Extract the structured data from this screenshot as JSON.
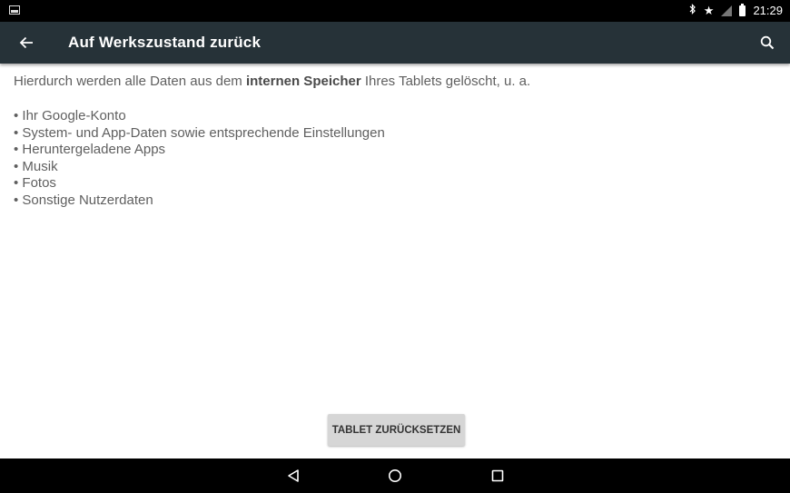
{
  "status_bar": {
    "time": "21:29",
    "icons": [
      "picture-icon",
      "bluetooth-icon",
      "star-icon",
      "signal-icon",
      "battery-icon"
    ]
  },
  "toolbar": {
    "title": "Auf Werkszustand zurück",
    "back_icon": "arrow-back-icon",
    "search_icon": "search-icon",
    "background": "#263238"
  },
  "content": {
    "intro_prefix": "Hierdurch werden alle Daten aus dem ",
    "intro_bold": "internen Speicher",
    "intro_suffix": " Ihres Tablets gelöscht, u. a.",
    "items": [
      "Ihr Google-Konto",
      "System- und App-Daten sowie entsprechende Einstellungen",
      "Heruntergeladene Apps",
      "Musik",
      "Fotos",
      "Sonstige Nutzerdaten"
    ]
  },
  "reset_button": {
    "label": "TABLET ZURÜCKSETZEN"
  },
  "nav_bar": {
    "icons": [
      "back-triangle-icon",
      "home-circle-icon",
      "recents-square-icon"
    ]
  }
}
